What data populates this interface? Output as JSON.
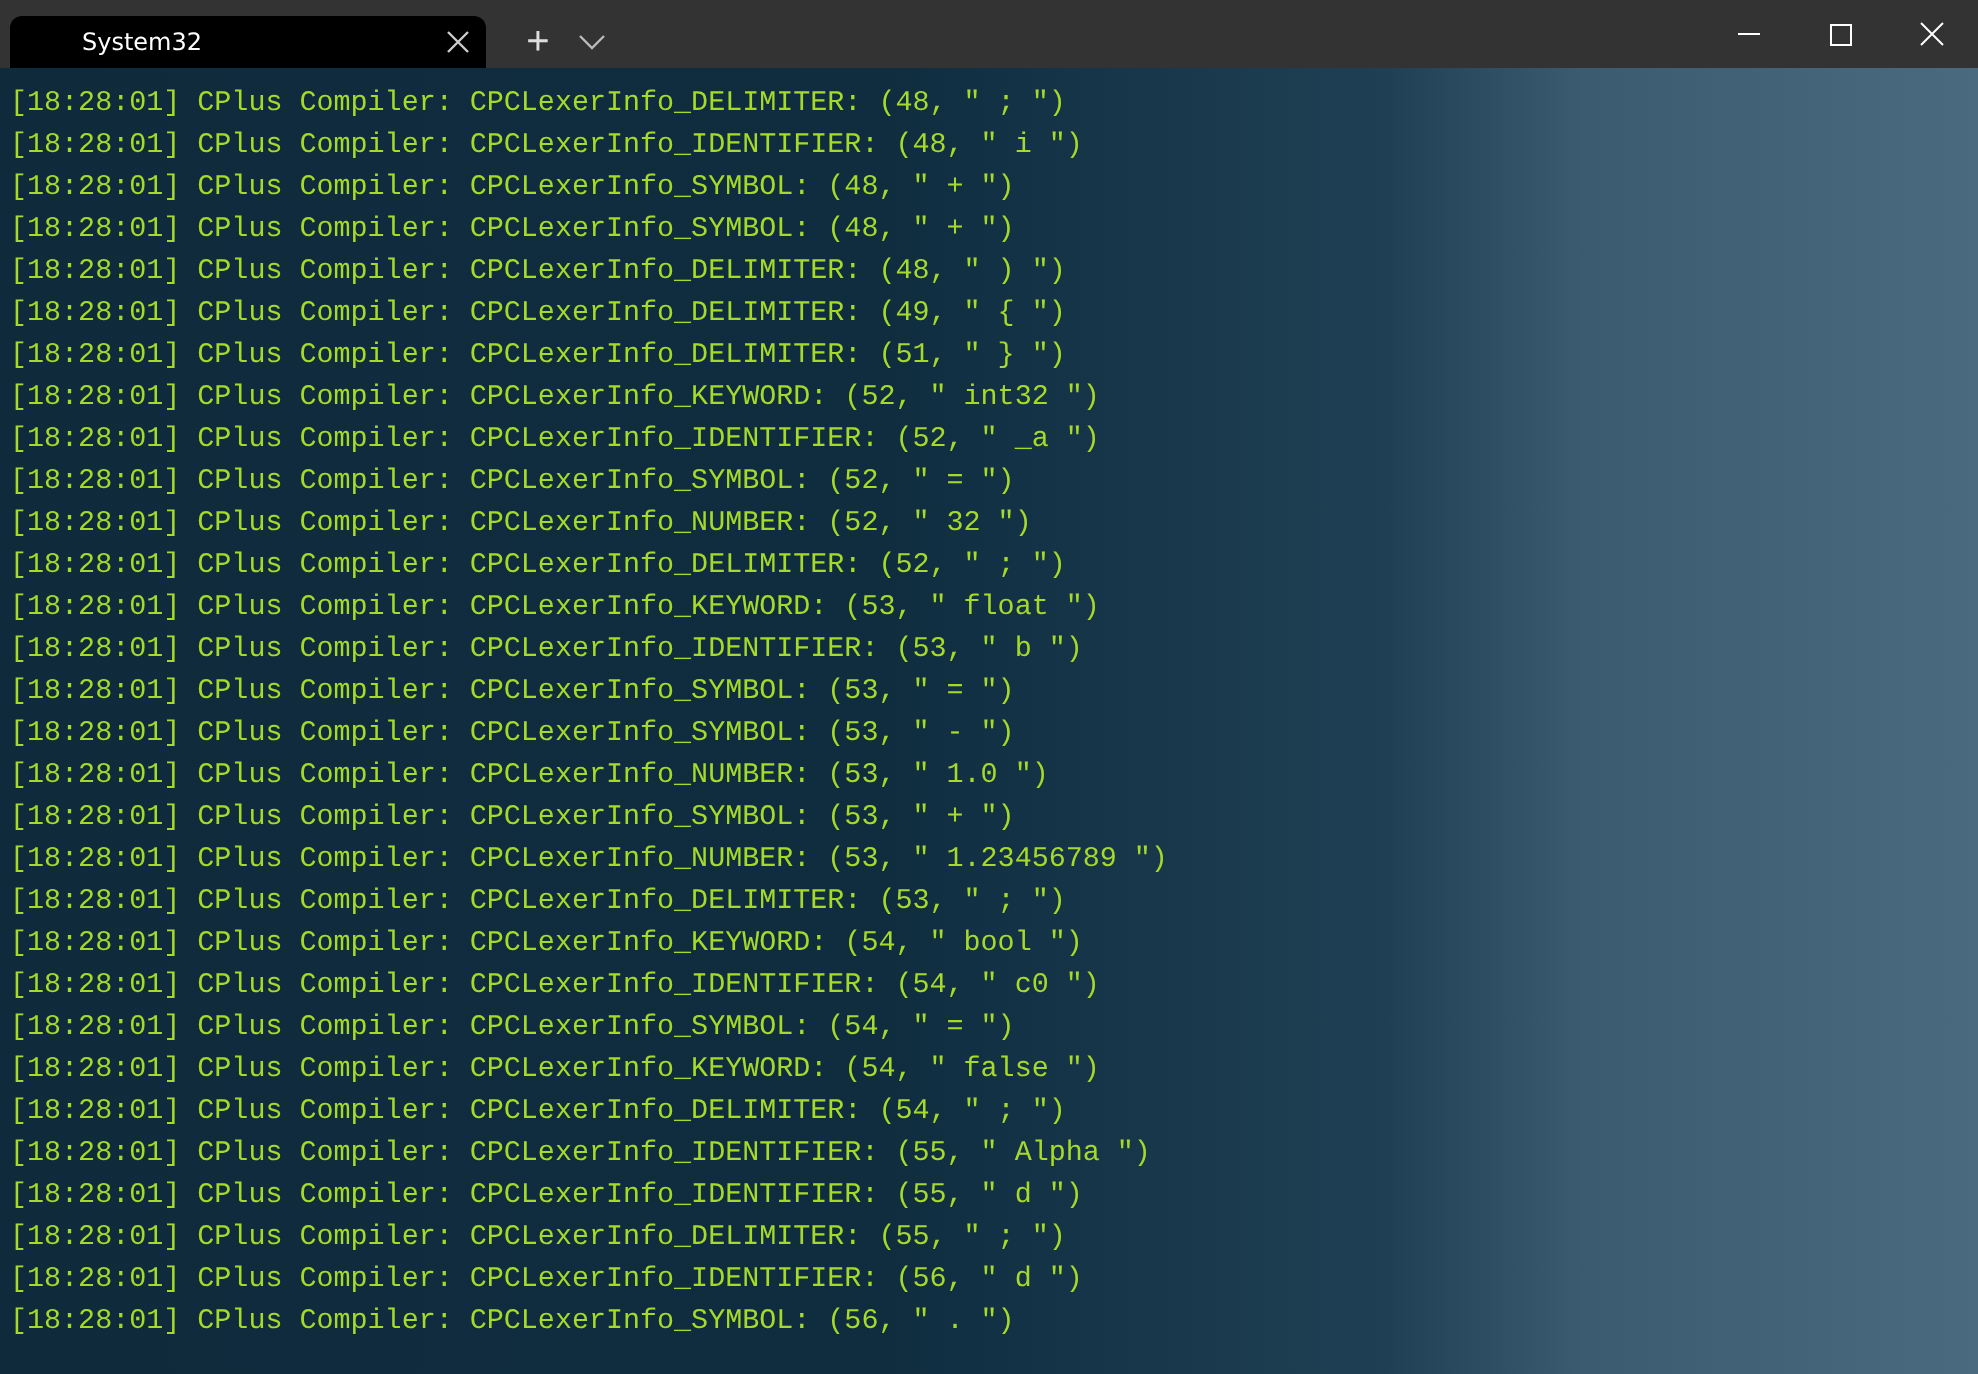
{
  "window": {
    "tab": {
      "title": "System32",
      "selected": true
    },
    "controls": {
      "new_tab": "+"
    }
  },
  "console": {
    "lines": [
      "[18:28:01] CPlus Compiler: CPCLexerInfo_DELIMITER: (48, \" ; \")",
      "[18:28:01] CPlus Compiler: CPCLexerInfo_IDENTIFIER: (48, \" i \")",
      "[18:28:01] CPlus Compiler: CPCLexerInfo_SYMBOL: (48, \" + \")",
      "[18:28:01] CPlus Compiler: CPCLexerInfo_SYMBOL: (48, \" + \")",
      "[18:28:01] CPlus Compiler: CPCLexerInfo_DELIMITER: (48, \" ) \")",
      "[18:28:01] CPlus Compiler: CPCLexerInfo_DELIMITER: (49, \" { \")",
      "[18:28:01] CPlus Compiler: CPCLexerInfo_DELIMITER: (51, \" } \")",
      "[18:28:01] CPlus Compiler: CPCLexerInfo_KEYWORD: (52, \" int32 \")",
      "[18:28:01] CPlus Compiler: CPCLexerInfo_IDENTIFIER: (52, \" _a \")",
      "[18:28:01] CPlus Compiler: CPCLexerInfo_SYMBOL: (52, \" = \")",
      "[18:28:01] CPlus Compiler: CPCLexerInfo_NUMBER: (52, \" 32 \")",
      "[18:28:01] CPlus Compiler: CPCLexerInfo_DELIMITER: (52, \" ; \")",
      "[18:28:01] CPlus Compiler: CPCLexerInfo_KEYWORD: (53, \" float \")",
      "[18:28:01] CPlus Compiler: CPCLexerInfo_IDENTIFIER: (53, \" b \")",
      "[18:28:01] CPlus Compiler: CPCLexerInfo_SYMBOL: (53, \" = \")",
      "[18:28:01] CPlus Compiler: CPCLexerInfo_SYMBOL: (53, \" - \")",
      "[18:28:01] CPlus Compiler: CPCLexerInfo_NUMBER: (53, \" 1.0 \")",
      "[18:28:01] CPlus Compiler: CPCLexerInfo_SYMBOL: (53, \" + \")",
      "[18:28:01] CPlus Compiler: CPCLexerInfo_NUMBER: (53, \" 1.23456789 \")",
      "[18:28:01] CPlus Compiler: CPCLexerInfo_DELIMITER: (53, \" ; \")",
      "[18:28:01] CPlus Compiler: CPCLexerInfo_KEYWORD: (54, \" bool \")",
      "[18:28:01] CPlus Compiler: CPCLexerInfo_IDENTIFIER: (54, \" c0 \")",
      "[18:28:01] CPlus Compiler: CPCLexerInfo_SYMBOL: (54, \" = \")",
      "[18:28:01] CPlus Compiler: CPCLexerInfo_KEYWORD: (54, \" false \")",
      "[18:28:01] CPlus Compiler: CPCLexerInfo_DELIMITER: (54, \" ; \")",
      "[18:28:01] CPlus Compiler: CPCLexerInfo_IDENTIFIER: (55, \" Alpha \")",
      "[18:28:01] CPlus Compiler: CPCLexerInfo_IDENTIFIER: (55, \" d \")",
      "[18:28:01] CPlus Compiler: CPCLexerInfo_DELIMITER: (55, \" ; \")",
      "[18:28:01] CPlus Compiler: CPCLexerInfo_IDENTIFIER: (56, \" d \")",
      "[18:28:01] CPlus Compiler: CPCLexerInfo_SYMBOL: (56, \" . \")"
    ]
  }
}
